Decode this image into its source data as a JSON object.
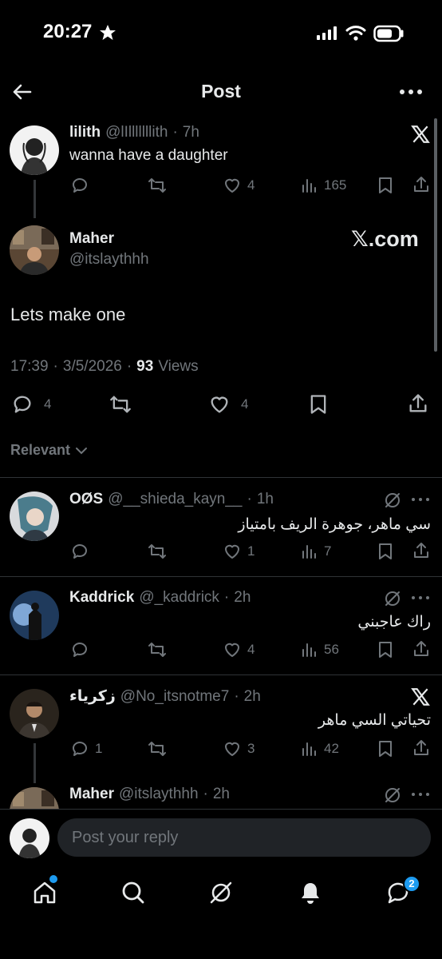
{
  "status_bar": {
    "time": "20:27"
  },
  "header": {
    "title": "Post"
  },
  "parent_post": {
    "name": "lilith",
    "handle": "@lIlllllllith",
    "time": "7h",
    "text": "wanna have a daughter",
    "likes": "4",
    "views": "165"
  },
  "main_post": {
    "name": "Maher",
    "handle": "@itslaythhh",
    "watermark": "𝕏.com",
    "text": "Lets make one",
    "time": "17:39",
    "date": "3/5/2026",
    "views_count": "93",
    "views_label": "Views",
    "replies": "4",
    "likes": "4"
  },
  "sort": {
    "label": "Relevant"
  },
  "replies": [
    {
      "name": "OØS",
      "handle": "@__shieda_kayn__",
      "time": "1h",
      "text": "سي ماهر، جوهرة الريف بامتياز",
      "replies": "",
      "likes": "1",
      "views": "7"
    },
    {
      "name": "Kaddrick",
      "handle": "@_kaddrick",
      "time": "2h",
      "text": "راك عاجبني",
      "replies": "",
      "likes": "4",
      "views": "56"
    },
    {
      "name": "زكرياء",
      "handle": "@No_itsnotme7",
      "time": "2h",
      "text": "تحياتي السي ماهر",
      "replies": "1",
      "likes": "3",
      "views": "42"
    },
    {
      "name": "Maher",
      "handle": "@itslaythhh",
      "time": "2h"
    }
  ],
  "composer": {
    "placeholder": "Post your reply"
  },
  "tab_bar": {
    "messages_badge": "2"
  },
  "colors": {
    "background": "#000000",
    "accent": "#1d9bf0",
    "muted": "#71767b",
    "text": "#e7e9ea"
  }
}
